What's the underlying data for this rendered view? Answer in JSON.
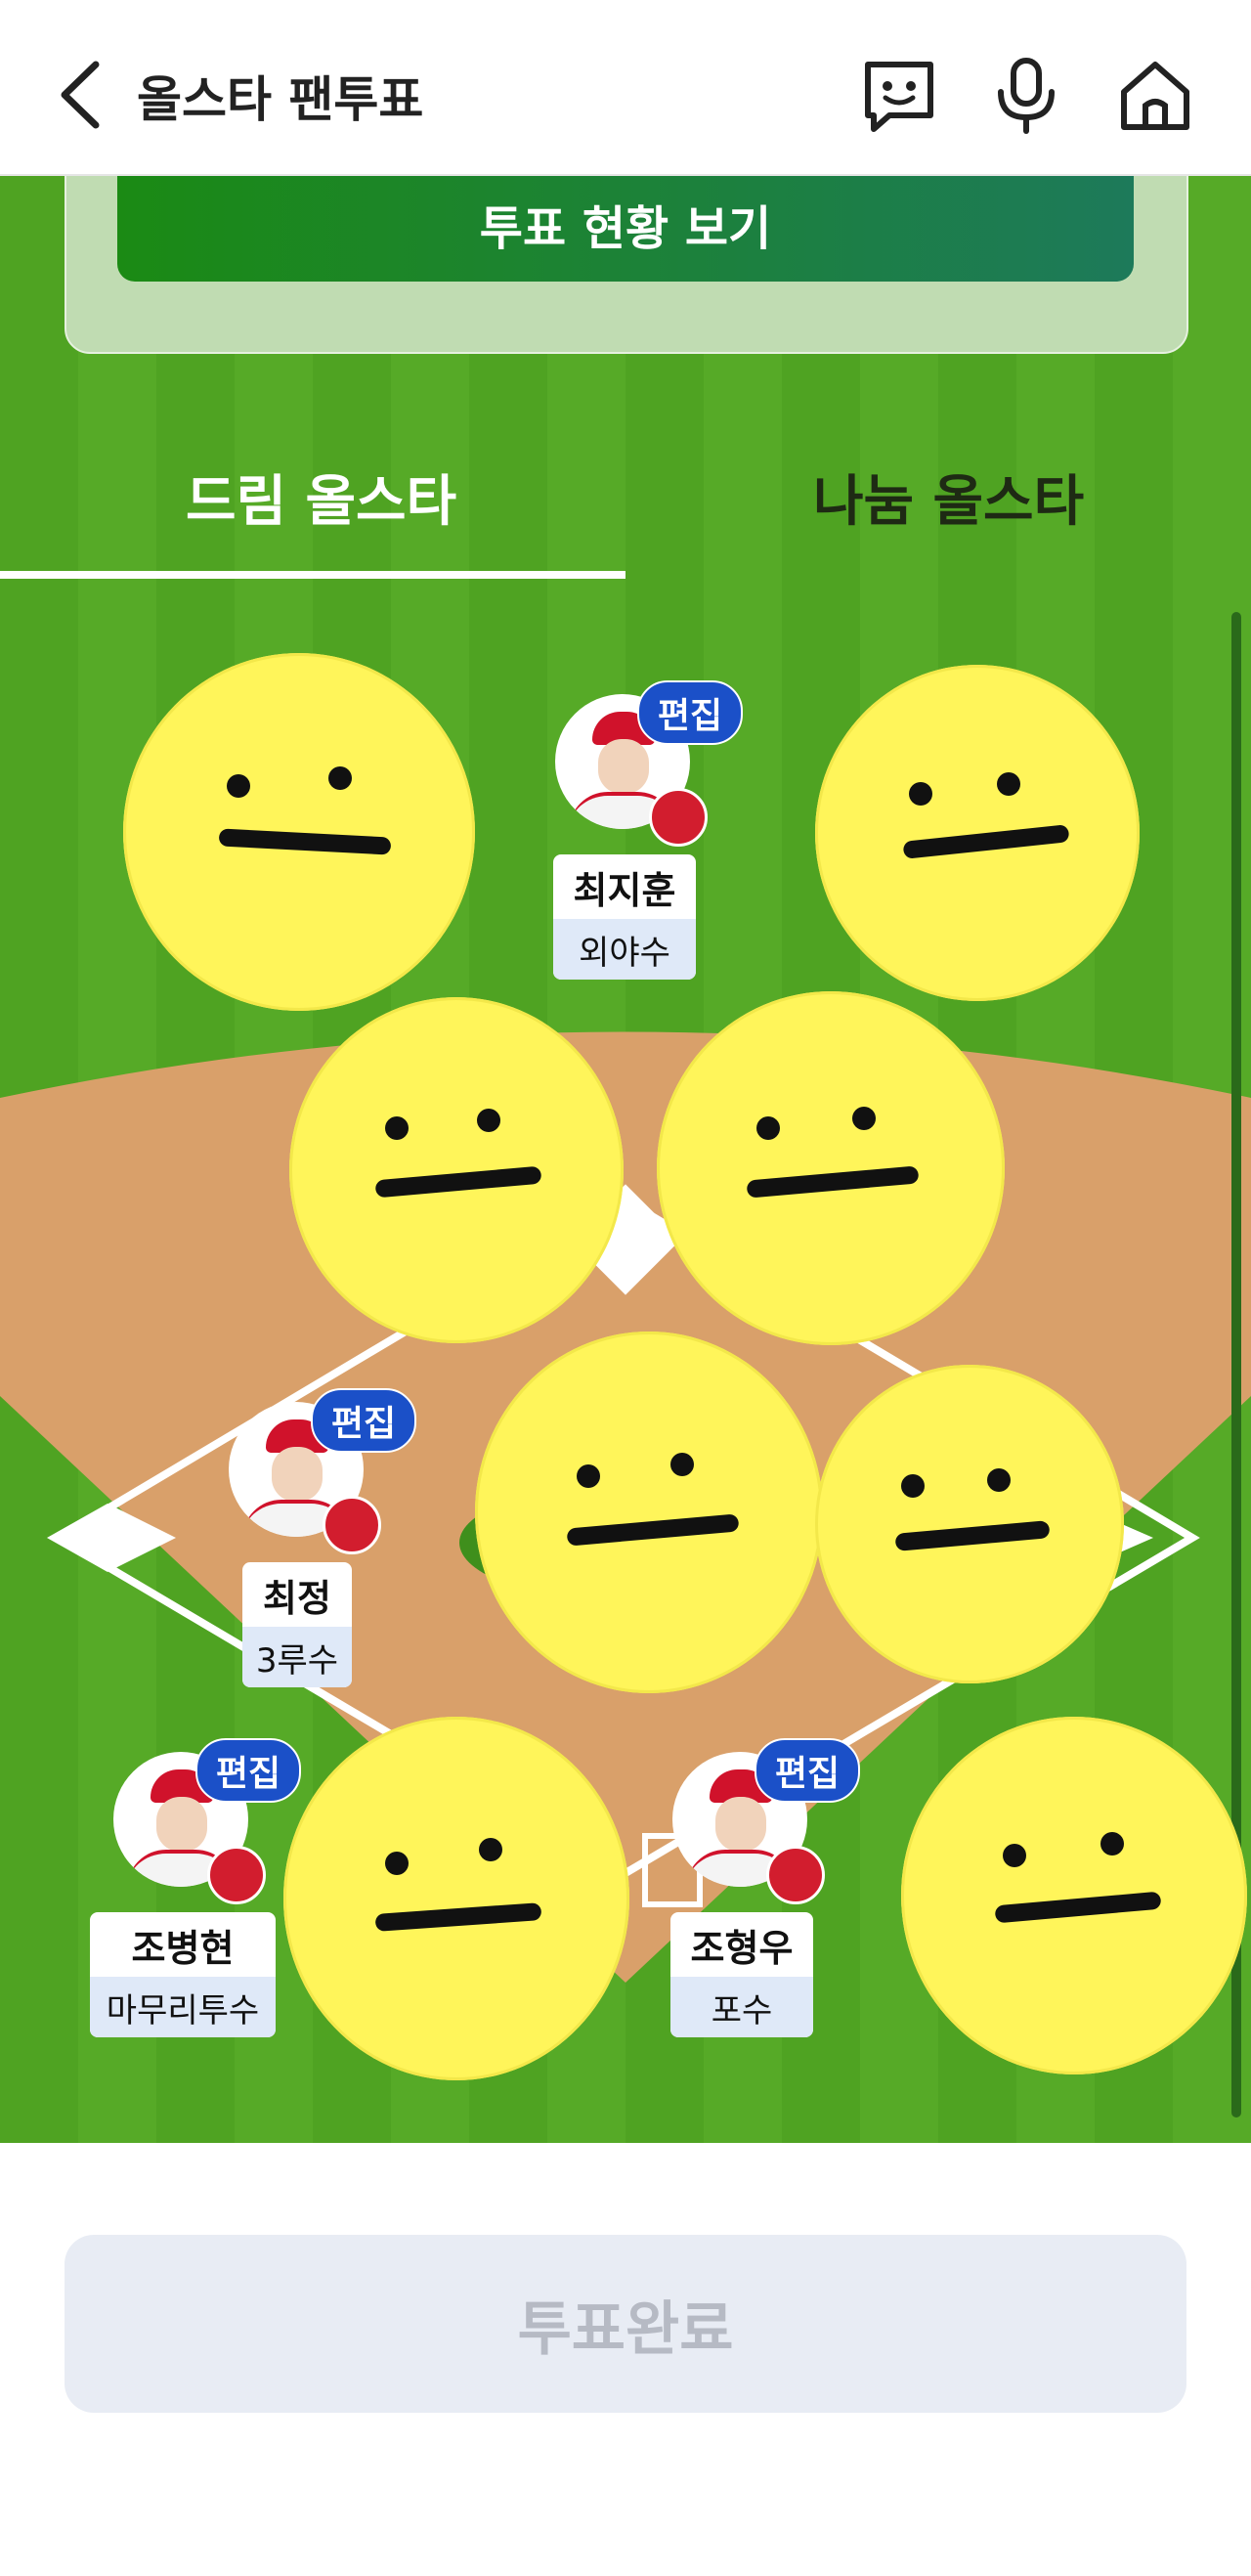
{
  "header": {
    "title": "올스타 팬투표",
    "icons": [
      "chevron-left-icon",
      "chatbot-icon",
      "microphone-icon",
      "home-icon"
    ]
  },
  "status": {
    "button_label": "투표 현황 보기"
  },
  "tabs": [
    {
      "label": "드림 올스타",
      "active": true
    },
    {
      "label": "나눔 올스타",
      "active": false
    }
  ],
  "players": [
    {
      "name": "최지훈",
      "position": "외야수",
      "edit_label": "편집"
    },
    {
      "name": "최정",
      "position": "3루수",
      "edit_label": "편집"
    },
    {
      "name": "조병현",
      "position": "마무리투수",
      "edit_label": "편집"
    },
    {
      "name": "조형우",
      "position": "포수",
      "edit_label": "편집"
    }
  ],
  "submit": {
    "label": "투표완료"
  },
  "colors": {
    "field": "#4fa322",
    "infield": "#d9a06a",
    "edit_badge": "#1b50c8",
    "team_red": "#d0122b",
    "emoji": "#fff55a"
  }
}
